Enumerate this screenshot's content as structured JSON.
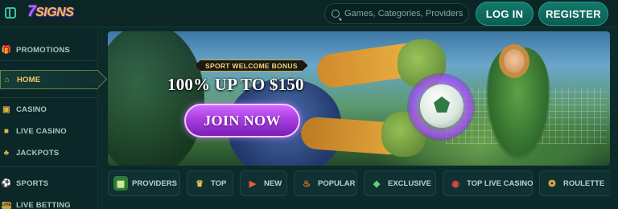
{
  "header": {
    "logo_text_num": "7",
    "logo_text": "SIGNS",
    "search_placeholder": "Games, Categories, Providers",
    "login_label": "LOG IN",
    "register_label": "REGISTER"
  },
  "sidebar": {
    "items": [
      {
        "label": "PROMOTIONS",
        "icon": "gift-icon"
      },
      {
        "label": "HOME",
        "icon": "home-icon",
        "active": true
      },
      {
        "label": "CASINO",
        "icon": "slot-machine-icon"
      },
      {
        "label": "LIVE CASINO",
        "icon": "live-casino-icon"
      },
      {
        "label": "JACKPOTS",
        "icon": "clover-icon"
      },
      {
        "label": "SPORTS",
        "icon": "soccer-ball-icon"
      },
      {
        "label": "LIVE BETTING",
        "icon": "live-badge-icon"
      }
    ]
  },
  "banner": {
    "tag": "SPORT WELCOME BONUS",
    "headline": "100% UP TO $150",
    "cta": "JOIN NOW"
  },
  "categories": [
    {
      "label": "PROVIDERS",
      "icon": "providers-icon"
    },
    {
      "label": "TOP",
      "icon": "crown-icon"
    },
    {
      "label": "NEW",
      "icon": "megaphone-icon"
    },
    {
      "label": "POPULAR",
      "icon": "fire-icon"
    },
    {
      "label": "EXCLUSIVE",
      "icon": "gem-icon"
    },
    {
      "label": "TOP LIVE CASINO",
      "icon": "chips-icon"
    },
    {
      "label": "ROULETTE",
      "icon": "roulette-icon"
    }
  ],
  "colors": {
    "background": "#0d2a2a",
    "accent_teal": "#127a6b",
    "accent_gold": "#f3d064",
    "cta_purple": "#a93ee0"
  }
}
